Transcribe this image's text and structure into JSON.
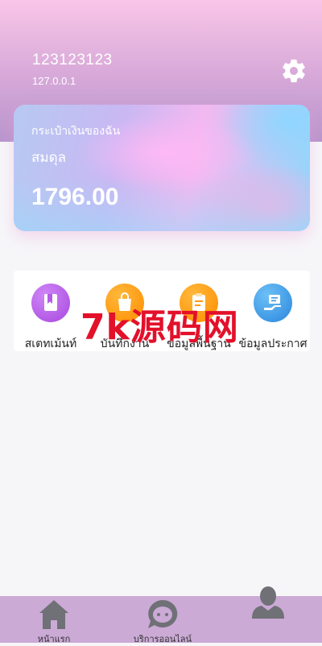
{
  "header": {
    "username": "123123123",
    "ip": "127.0.0.1",
    "settings_icon": "gear-icon"
  },
  "wallet": {
    "title": "กระเป๋าเงินของฉัน",
    "subtitle": "สมดุล",
    "amount": "1796.00"
  },
  "menu": {
    "items": [
      {
        "label": "สเตทเม้นท์",
        "icon": "statement-icon",
        "color": "#b45be8"
      },
      {
        "label": "บันทึกงาน",
        "icon": "bag-icon",
        "color": "#ff9a0a"
      },
      {
        "label": "ข้อมูลพื้นฐาน",
        "icon": "clipboard-icon",
        "color": "#ff9a0a"
      },
      {
        "label": "ข้อมูลประกาศ",
        "icon": "announcement-icon",
        "color": "#3b98e8"
      }
    ]
  },
  "watermark": "7k源码网",
  "bottom_nav": {
    "items": [
      {
        "label": "หน้าแรก",
        "icon": "home-icon"
      },
      {
        "label": "บริการออนไลน์",
        "icon": "chat-icon"
      },
      {
        "label": "",
        "icon": "user-icon"
      }
    ]
  },
  "colors": {
    "header_top": "#f9c6e8",
    "header_bottom": "#b895cd",
    "nav_bg": "#cbaad6",
    "watermark": "#e3102a"
  }
}
